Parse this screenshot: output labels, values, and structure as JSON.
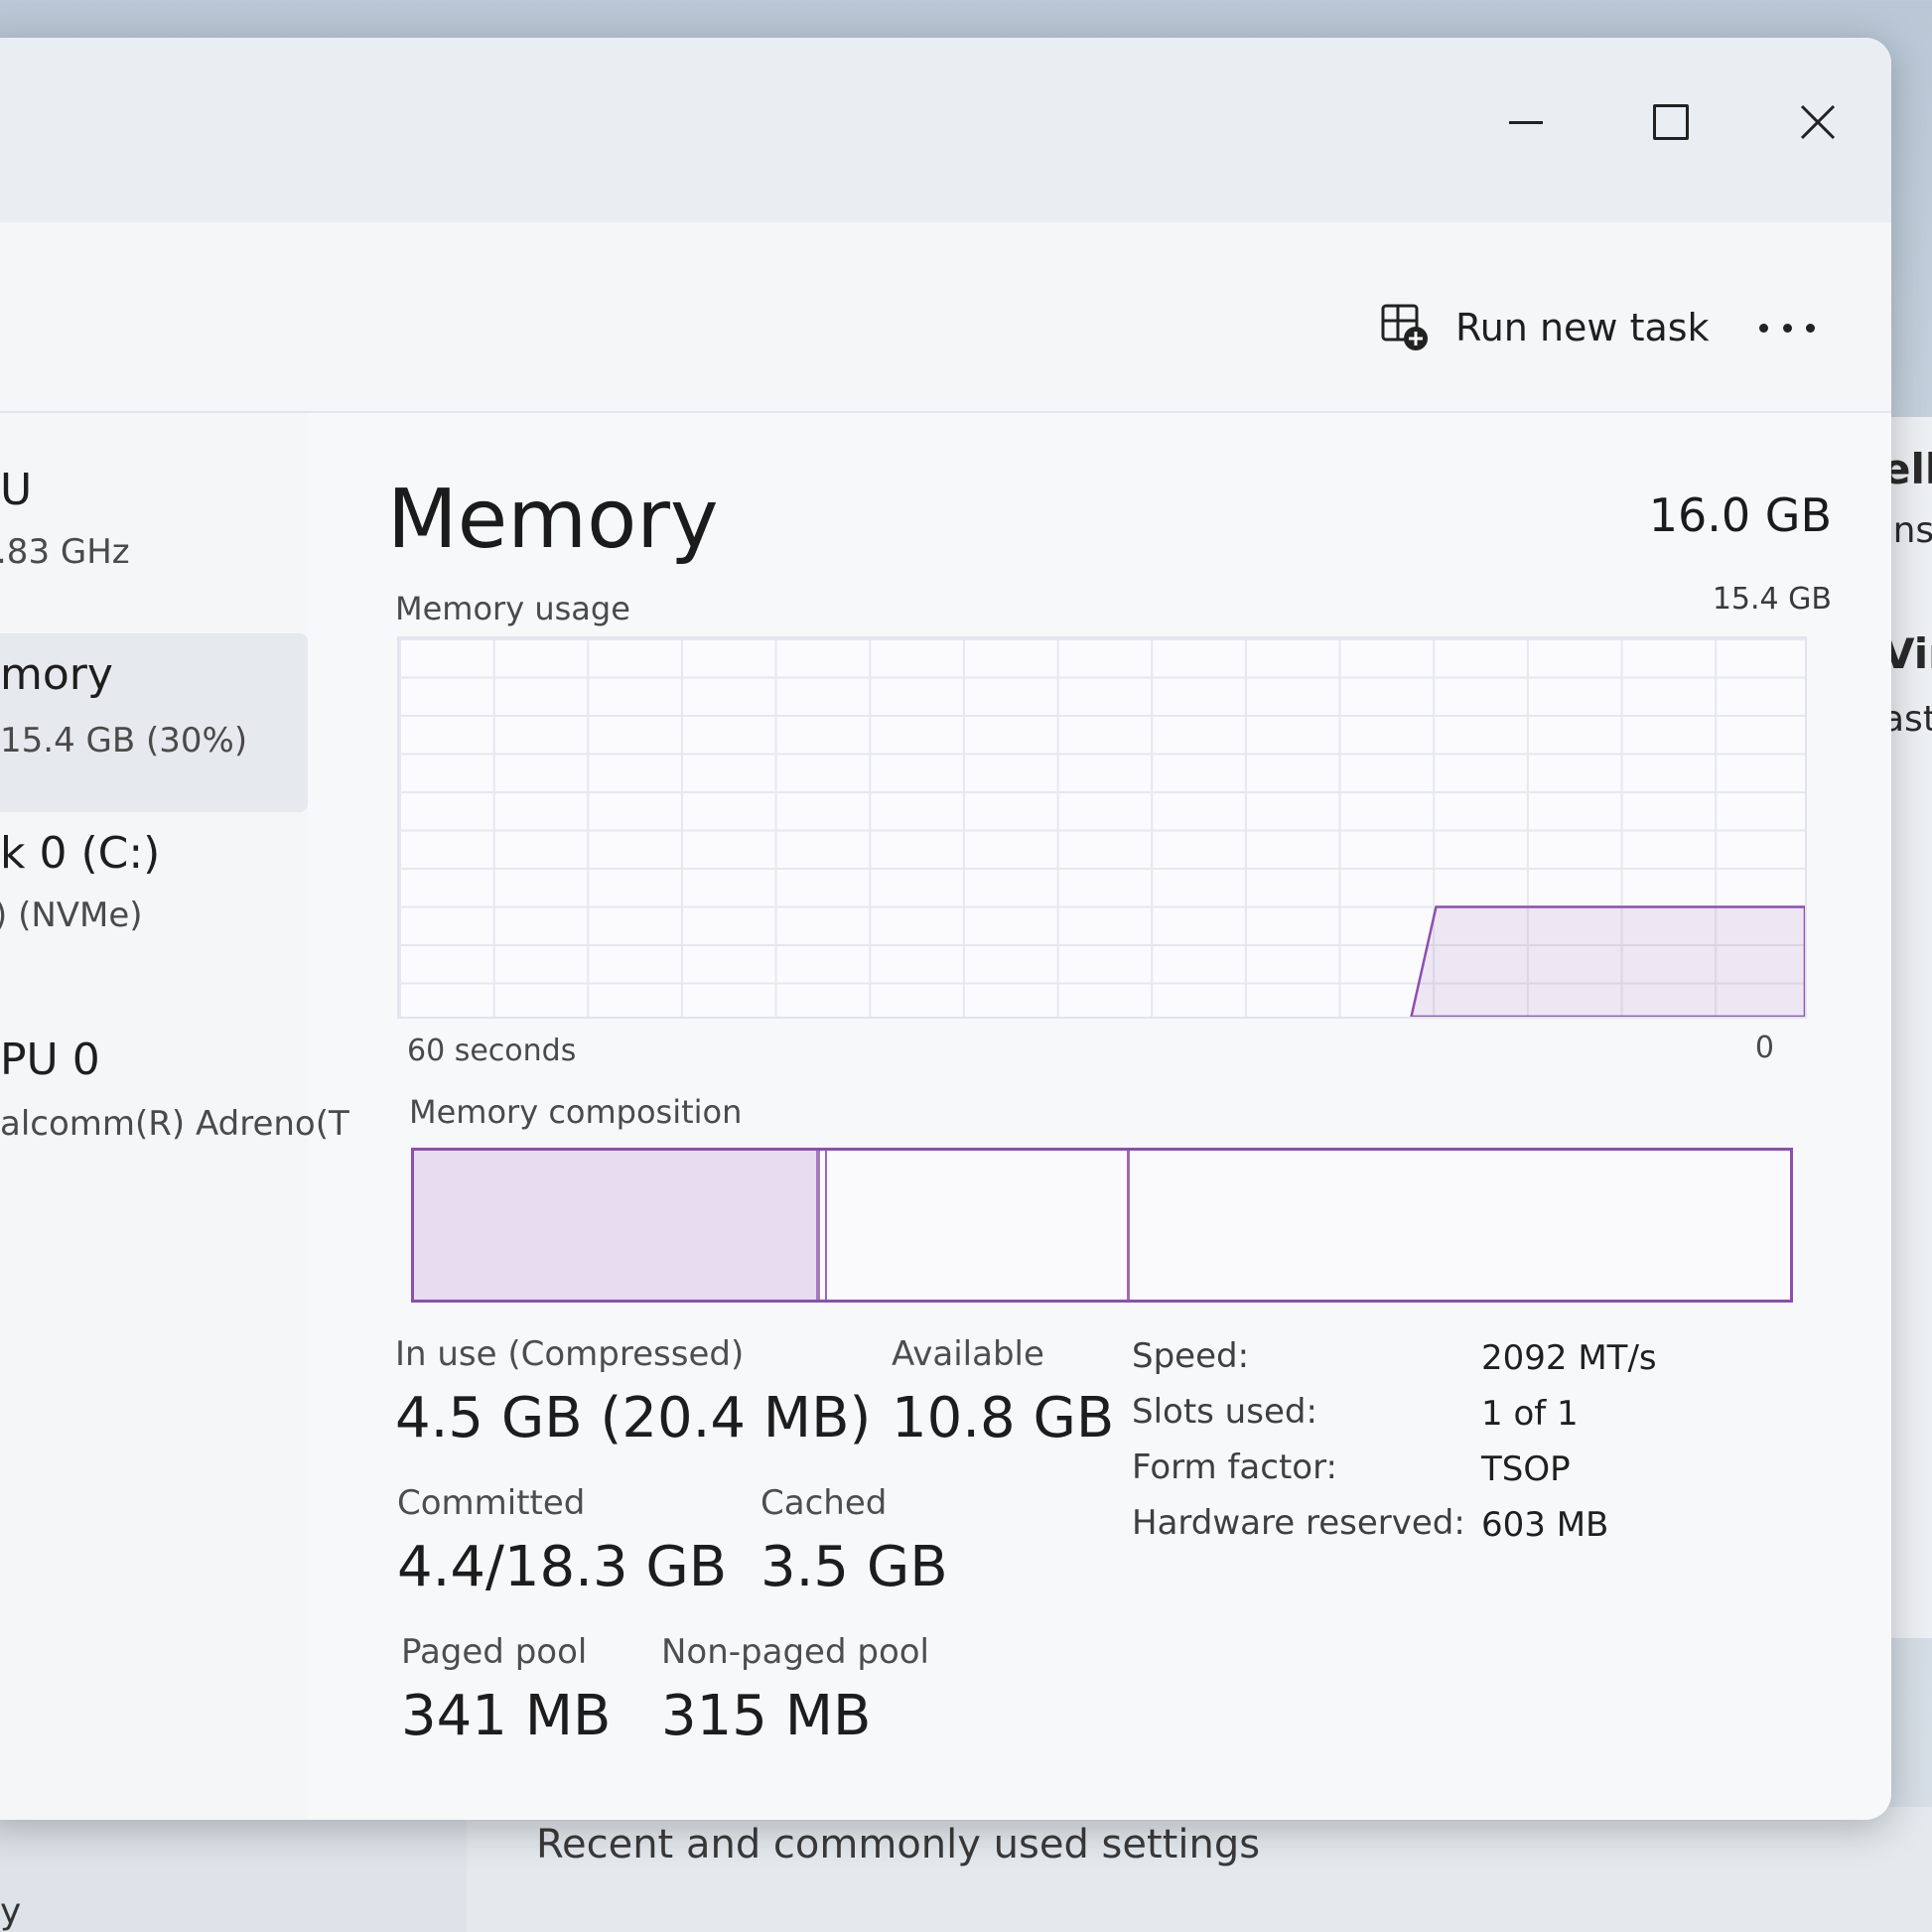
{
  "window": {
    "controls": {
      "minimize": "minimize",
      "maximize": "maximize",
      "close": "close"
    }
  },
  "toolbar": {
    "run_new_task": "Run new task",
    "more_icon": "more-horizontal-icon"
  },
  "sidebar": {
    "items": [
      {
        "title": "U",
        "sub": ".83 GHz"
      },
      {
        "title": "mory",
        "sub": "15.4 GB (30%)"
      },
      {
        "title": "k 0 (C:)",
        "sub": ") (NVMe)"
      },
      {
        "title": "PU 0",
        "sub": "alcomm(R) Adreno(T"
      }
    ]
  },
  "main": {
    "title": "Memory",
    "total": "16.0 GB",
    "usage_label": "Memory usage",
    "usage_max": "15.4 GB",
    "seconds_label": "60 seconds",
    "zero_label": "0",
    "composition_label": "Memory composition",
    "usage_graph": {
      "used_fraction": 0.29,
      "visible_history_start_fraction": 0.72
    },
    "composition": {
      "in_use_fraction": 0.295,
      "modified_fraction": 0.005,
      "standby_fraction": 0.22
    },
    "stats": {
      "in_use": {
        "label": "In use (Compressed)",
        "value": "4.5 GB (20.4 MB)"
      },
      "available": {
        "label": "Available",
        "value": "10.8 GB"
      },
      "committed": {
        "label": "Committed",
        "value": "4.4/18.3 GB"
      },
      "cached": {
        "label": "Cached",
        "value": "3.5 GB"
      },
      "paged_pool": {
        "label": "Paged pool",
        "value": "341 MB"
      },
      "non_paged_pool": {
        "label": "Non-paged pool",
        "value": "315 MB"
      }
    },
    "specs": [
      {
        "key": "Speed:",
        "value": "2092 MT/s"
      },
      {
        "key": "Slots used:",
        "value": "1 of 1"
      },
      {
        "key": "Form factor:",
        "value": "TSOP"
      },
      {
        "key": "Hardware reserved:",
        "value": "603 MB"
      }
    ]
  },
  "background": {
    "right_fragments": [
      "ell",
      "Ins",
      "Vin",
      "ast"
    ],
    "bottom_label": "Recent and commonly used settings",
    "bottom_corner": "y"
  },
  "colors": {
    "memory_accent": "#8b4fb0",
    "in_use_fill": "#e8dcef"
  }
}
